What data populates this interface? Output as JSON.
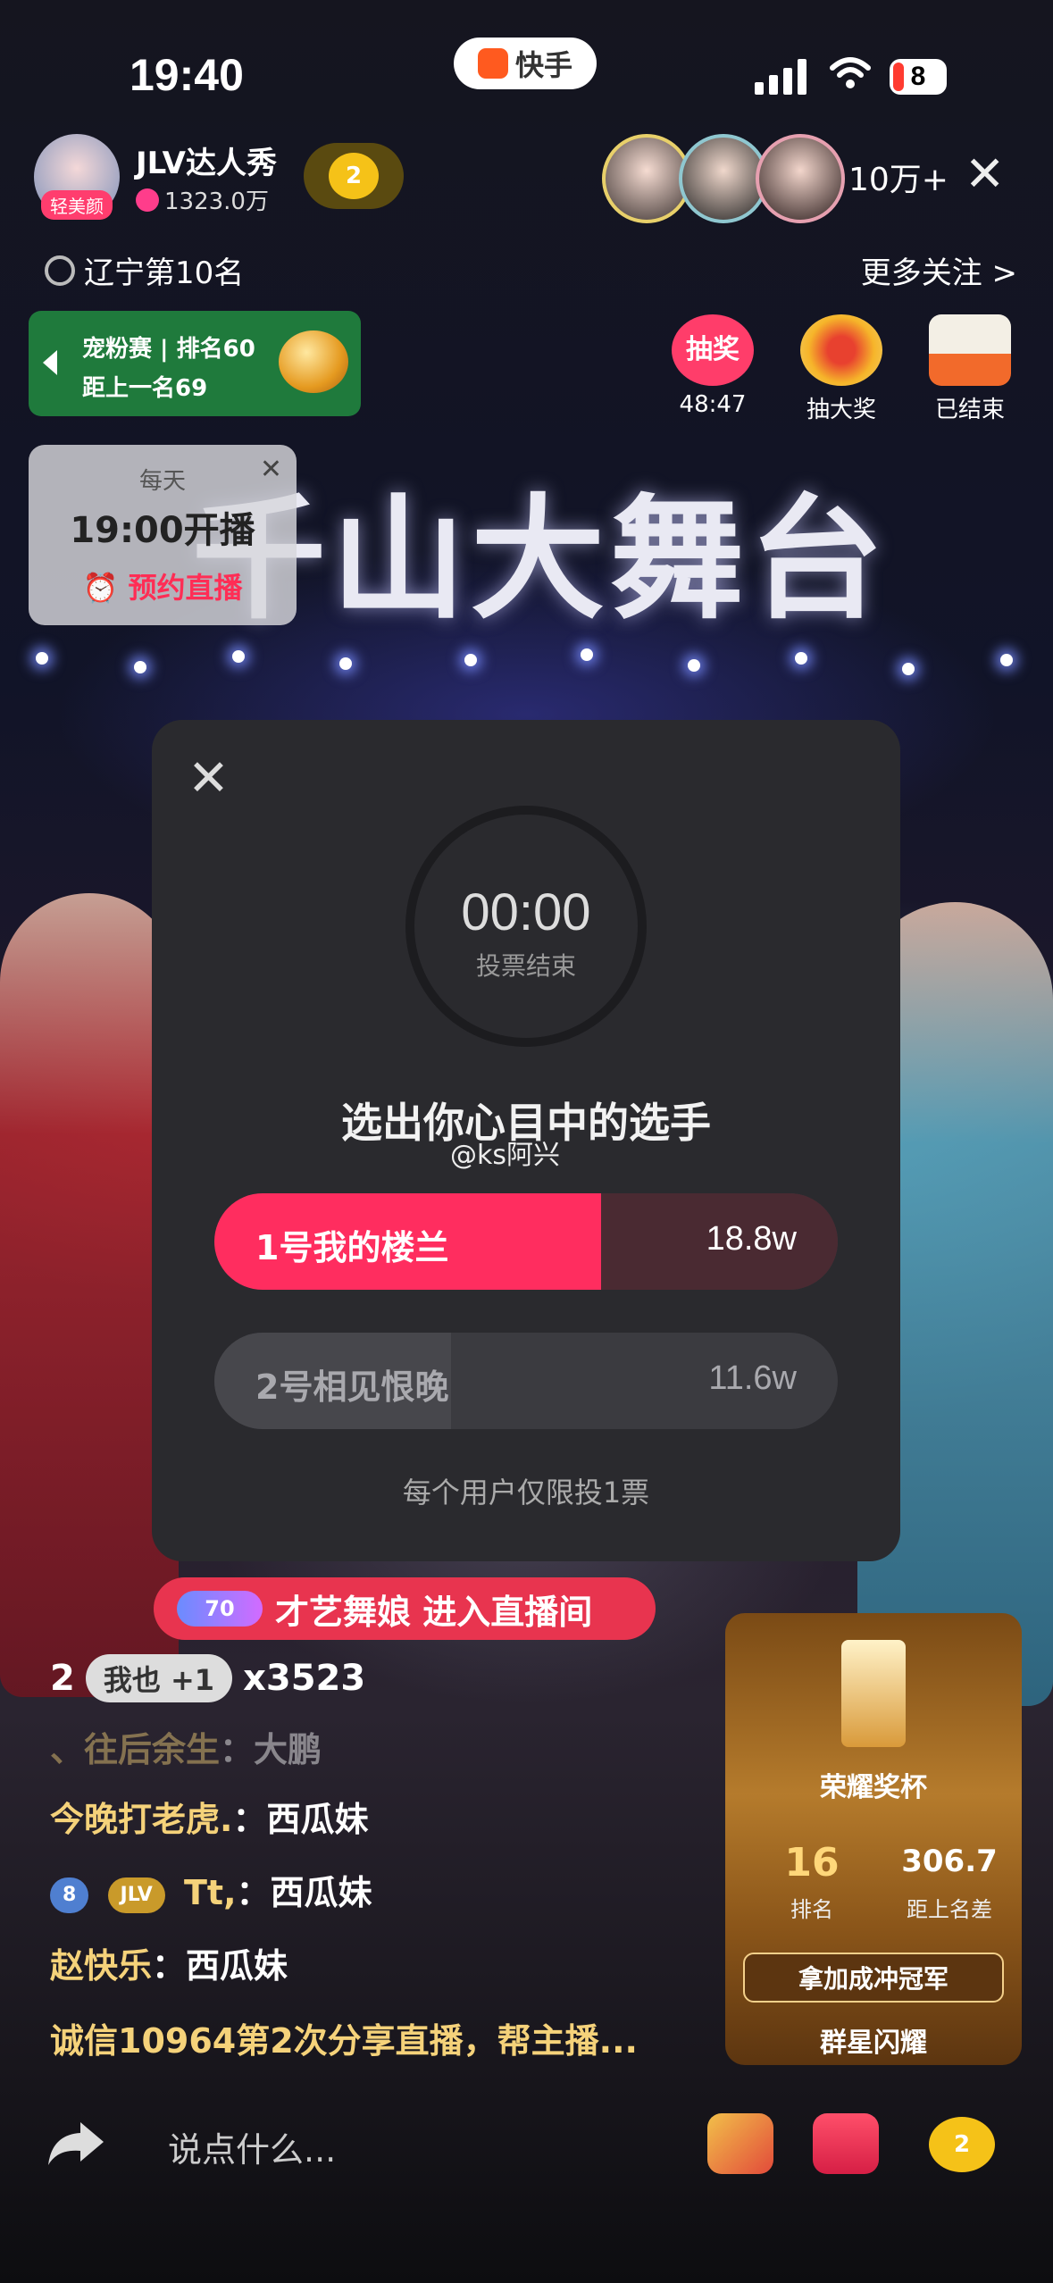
{
  "status_bar": {
    "time": "19:40",
    "app_name": "快手",
    "battery": "8"
  },
  "host": {
    "name": "JLV达人秀",
    "likes": "1323.0万",
    "tag": "轻美颜",
    "follow_badge": "2"
  },
  "viewers": "10万+",
  "rank_location": "辽宁第10名",
  "more_follow": "更多关注 >",
  "rank_card": {
    "line1": "宠粉赛 | 排名60",
    "line2": "距上一名69"
  },
  "activities": [
    {
      "label": "48:47",
      "icon": "lottery-icon",
      "icon_text": "抽奖"
    },
    {
      "label": "抽大奖",
      "icon": "grand-prize-icon"
    },
    {
      "label": "已结束",
      "icon": "checkbox-icon"
    }
  ],
  "reserve": {
    "line1": "每天",
    "line2": "19:00开播",
    "button": "预约直播"
  },
  "stage_title": "千山大舞台",
  "vote": {
    "timer": "00:00",
    "timer_sub": "投票结束",
    "headline": "选出你心目中的选手",
    "watermark": "@ks阿兴",
    "options": [
      {
        "label": "1号我的楼兰",
        "votes": "18.8w",
        "share": 0.62
      },
      {
        "label": "2号相见恨晚",
        "votes": "11.6w",
        "share": 0.38
      }
    ],
    "note": "每个用户仅限投1票"
  },
  "enter_banner": {
    "level": "70",
    "text": "才艺舞娘 进入直播间"
  },
  "combo": {
    "count": "2",
    "button": "我也 +1",
    "multiplier": "x3523"
  },
  "chat": [
    {
      "user": "、往后余生",
      "content": "：大鹏"
    },
    {
      "user": "今晚打老虎.",
      "content": "：西瓜妹"
    },
    {
      "badges": [
        "8",
        "JLV"
      ],
      "user": "Tt,",
      "content": "：西瓜妹"
    },
    {
      "user": "赵快乐",
      "content": "：西瓜妹"
    },
    {
      "user": "诚信10964第2次分享直播，帮主播...",
      "content": ""
    }
  ],
  "honor": {
    "title": "荣耀奖杯",
    "rank": "16",
    "rank_label": "排名",
    "distance": "306.7",
    "distance_label": "距上名差",
    "cta": "拿加成冲冠军",
    "footer": "群星闪耀"
  },
  "bottom": {
    "placeholder": "说点什么...",
    "heart_count": "2"
  },
  "colors": {
    "vote_accent": "#ff2d5f",
    "gold": "#f5d27a",
    "green_card": "#1f7a3c"
  }
}
